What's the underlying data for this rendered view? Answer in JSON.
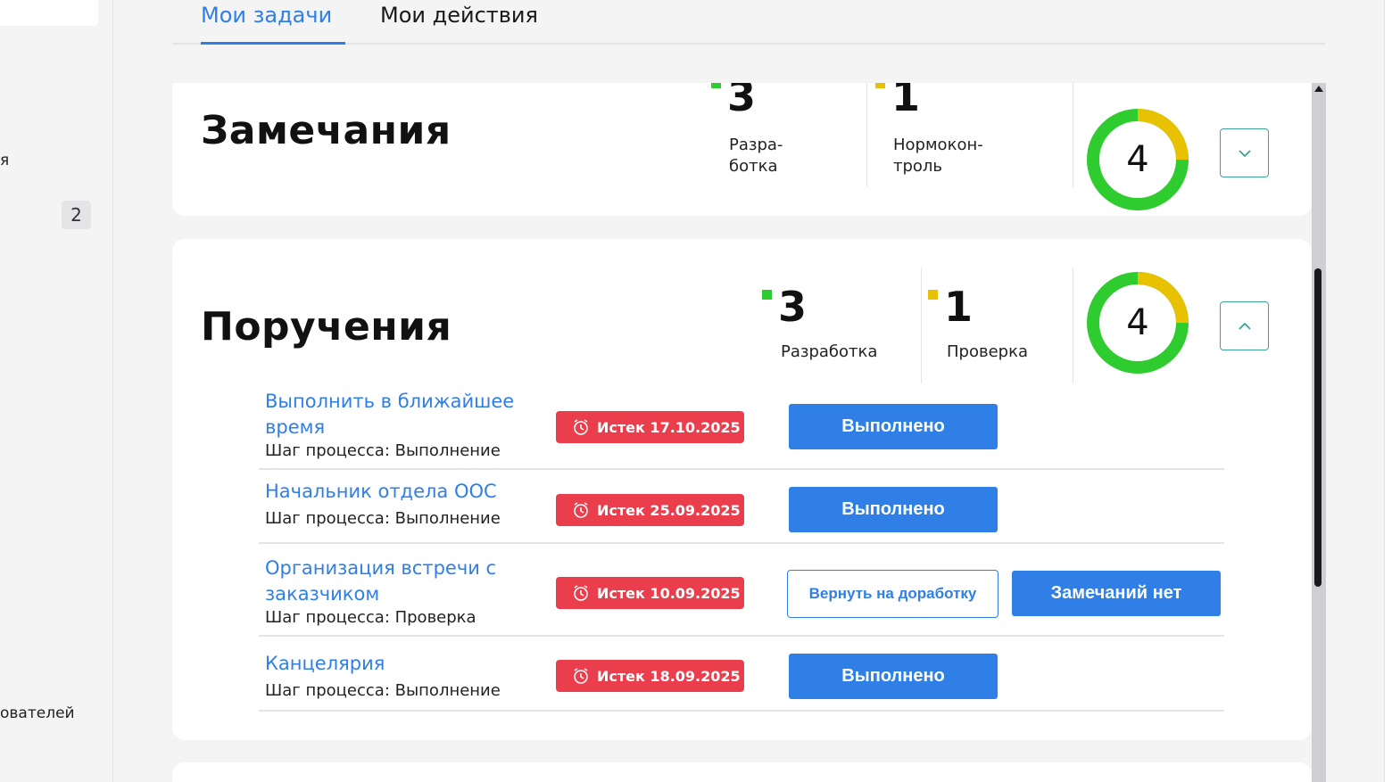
{
  "sidebar": {
    "fragment_top": "я",
    "badge_count": "2",
    "fragment_bottom": "ователей"
  },
  "tabs": [
    {
      "label": "Мои задачи",
      "active": true
    },
    {
      "label": "Мои действия",
      "active": false
    }
  ],
  "colors": {
    "accent": "#2f7fe6",
    "deadline_red": "#ea3e4d",
    "status_green": "#2ecc2e",
    "status_yellow": "#e8c200",
    "toggle_border": "#3aa39a"
  },
  "remarks": {
    "title": "Замечания",
    "stats": [
      {
        "count": "3",
        "label_line1": "Разра-",
        "label_line2": "ботка",
        "color": "green"
      },
      {
        "count": "1",
        "label_line1": "Нормокон-",
        "label_line2": "троль",
        "color": "yellow"
      }
    ],
    "total": "4",
    "total_green_fraction": 0.75,
    "total_yellow_fraction": 0.25,
    "toggle_icon": "chevron-down-icon"
  },
  "orders": {
    "title": "Поручения",
    "stats": [
      {
        "count": "3",
        "label": "Разработка",
        "color": "green"
      },
      {
        "count": "1",
        "label": "Проверка",
        "color": "yellow"
      }
    ],
    "total": "4",
    "total_green_fraction": 0.75,
    "total_yellow_fraction": 0.25,
    "toggle_icon": "chevron-up-icon",
    "tasks": [
      {
        "name": "Выполнить в ближайшее время",
        "step": "Шаг процесса: Выполнение",
        "deadline": "Истек 17.10.2025",
        "action": "Выполнено"
      },
      {
        "name": "Начальник отдела ООС",
        "step": "Шаг процесса: Выполнение",
        "deadline": "Истек 25.09.2025",
        "action": "Выполнено"
      },
      {
        "name": "Организация встречи с заказчиком",
        "step": "Шаг процесса: Проверка",
        "deadline": "Истек 10.09.2025",
        "action_secondary": "Вернуть на доработку",
        "action": "Замечаний нет"
      },
      {
        "name": "Канцелярия",
        "step": "Шаг процесса: Выполнение",
        "deadline": "Истек 18.09.2025",
        "action": "Выполнено"
      }
    ]
  }
}
